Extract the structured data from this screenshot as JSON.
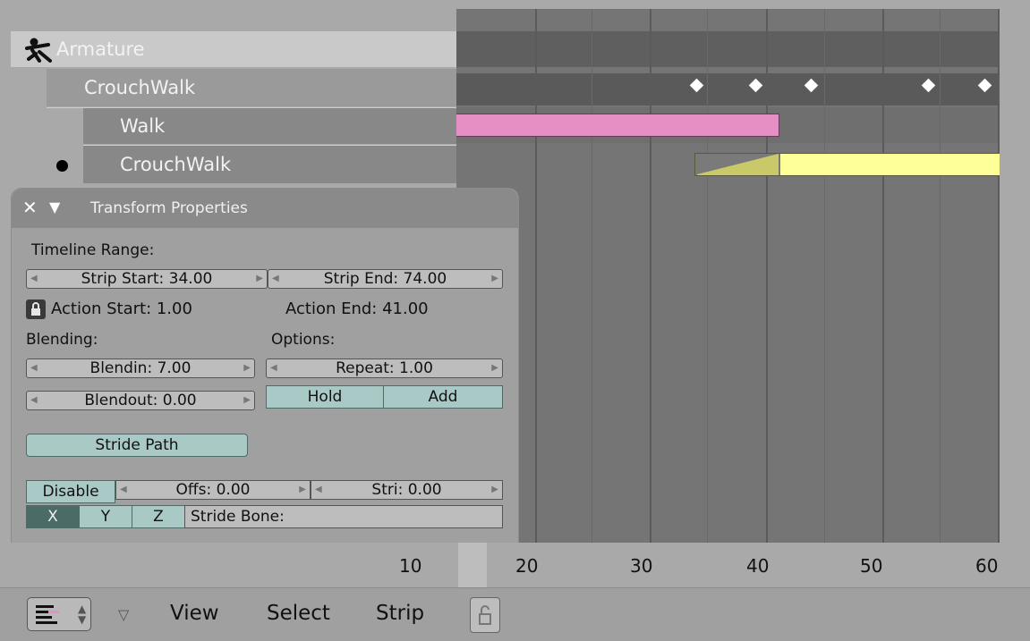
{
  "channels": {
    "armature": "Armature",
    "action_top": "CrouchWalk",
    "strip_walk": "Walk",
    "strip_crouch": "CrouchWalk"
  },
  "panel": {
    "title": "Transform Properties",
    "timeline_range_label": "Timeline Range:",
    "strip_start": "Strip Start: 34.00",
    "strip_end": "Strip End: 74.00",
    "action_start": "Action Start: 1.00",
    "action_end": "Action End: 41.00",
    "blending_label": "Blending:",
    "options_label": "Options:",
    "blendin": "Blendin: 7.00",
    "blendout": "Blendout: 0.00",
    "repeat": "Repeat: 1.00",
    "hold": "Hold",
    "add": "Add",
    "stride_path": "Stride Path",
    "disable": "Disable",
    "offs": "Offs: 0.00",
    "stri": "Stri: 0.00",
    "x": "X",
    "y": "Y",
    "z": "Z",
    "stride_bone": "Stride Bone:"
  },
  "ruler": {
    "ticks": [
      "10",
      "20",
      "30",
      "40",
      "50",
      "60"
    ]
  },
  "menu": {
    "view": "View",
    "select": "Select",
    "strip": "Strip"
  },
  "colors": {
    "walk_strip": "#e58fc5",
    "crouch_strip": "#ffff9a",
    "blend_ramp": "#c9c96a",
    "keyframe": "#ffffff",
    "button_teal": "#a9c9c6",
    "button_dark": "#4b6b69"
  },
  "icons": [
    "armature-icon",
    "close-icon",
    "collapse-triangle-icon",
    "lock-icon",
    "editor-type-icon",
    "menu-arrow-icon",
    "pin-icon",
    "active-dot-icon"
  ]
}
